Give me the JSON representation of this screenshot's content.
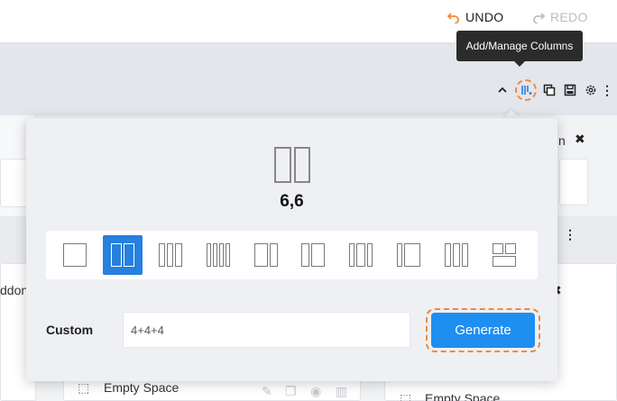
{
  "topbar": {
    "undo_label": "UNDO",
    "redo_label": "REDO"
  },
  "tooltip": {
    "text": "Add/Manage Columns"
  },
  "toolbar": {
    "icons": [
      "chevron-up-icon",
      "columns-icon",
      "copy-icon",
      "save-icon",
      "gear-icon",
      "more-icon"
    ]
  },
  "popup": {
    "preview_label": "6,6",
    "layouts": [
      "12",
      "6,6",
      "4,4,4",
      "3,3,3,3",
      "8,4",
      "4,8",
      "3,6,3",
      "2,10",
      "4,4,4-b",
      "grid"
    ],
    "selected_layout": "6,6",
    "custom_label": "Custom",
    "custom_value": "4+4+4",
    "generate_label": "Generate"
  },
  "background": {
    "fragment_text_1": "ddon",
    "fragment_text_2": "n",
    "empty_space_1": "Empty Space",
    "empty_space_2": "Empty Space"
  },
  "colors": {
    "accent": "#2680de",
    "generate": "#1f8ef1",
    "highlight": "#f08a3e"
  }
}
